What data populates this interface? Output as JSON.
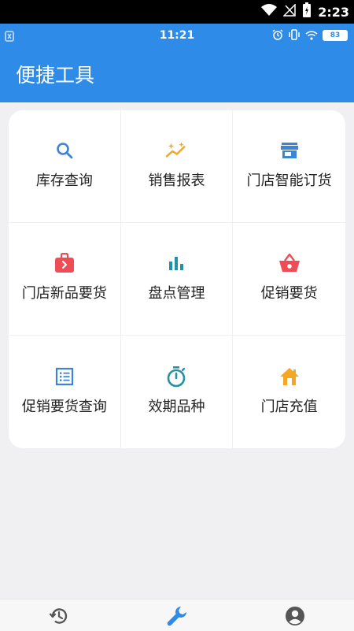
{
  "status_bar": {
    "time": "2:23"
  },
  "inner_status_bar": {
    "time": "11:21",
    "battery": "83"
  },
  "appbar": {
    "title": "便捷工具"
  },
  "colors": {
    "primary": "#2f8be8",
    "search": "#3c84d8",
    "orange": "#f5a623",
    "red": "#ef4c55",
    "teal": "#2591a8"
  },
  "tools": [
    {
      "label": "库存查询",
      "icon": "search-icon"
    },
    {
      "label": "销售报表",
      "icon": "trend-sparkle-icon"
    },
    {
      "label": "门店智能订货",
      "icon": "store-icon"
    },
    {
      "label": "门店新品要货",
      "icon": "shopping-bag-icon"
    },
    {
      "label": "盘点管理",
      "icon": "bar-chart-icon"
    },
    {
      "label": "促销要货",
      "icon": "basket-icon"
    },
    {
      "label": "促销要货查询",
      "icon": "list-icon"
    },
    {
      "label": "效期品种",
      "icon": "timer-icon"
    },
    {
      "label": "门店充值",
      "icon": "home-icon"
    }
  ],
  "bottom_nav": [
    {
      "icon": "history-icon",
      "active": false
    },
    {
      "icon": "wrench-icon",
      "active": true
    },
    {
      "icon": "account-icon",
      "active": false
    }
  ]
}
